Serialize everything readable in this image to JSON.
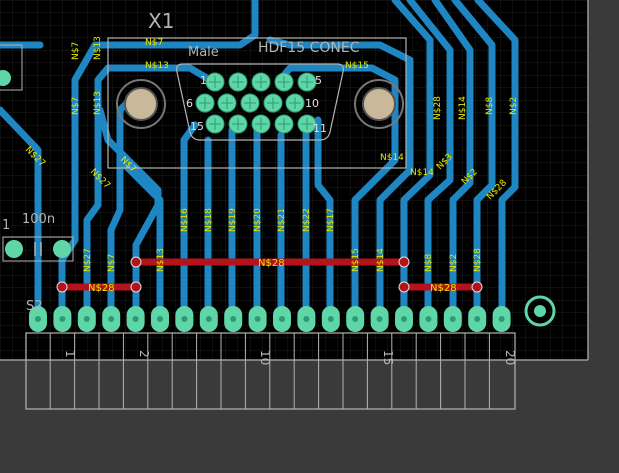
{
  "colors": {
    "canvas": "#3a3a3a",
    "board": "#000000",
    "grid": "#1c1c1c",
    "outline": "#b4b4b4",
    "trace_bottom": "#1e86c2",
    "trace_top": "#b3131a",
    "pad": "#5fd6a8",
    "text": "#e6e600",
    "silk": "#b0b0b0"
  },
  "component": {
    "name": "X1",
    "package": "HDF15 CONEC",
    "gender": "Male",
    "pin_labels": [
      "1",
      "5",
      "6",
      "10",
      "15",
      "11"
    ]
  },
  "capacitor": {
    "value": "100n",
    "index_label": "1"
  },
  "header": {
    "ref_fragment": "S2",
    "pin_numbers": [
      "1",
      "2",
      "10",
      "15",
      "20"
    ]
  },
  "nets": {
    "top_left": [
      "N$7",
      "N$13",
      "N$7",
      "N$13"
    ],
    "connector_top": [
      "N$7",
      "N$13",
      "N$15",
      "N$14",
      "N$14"
    ],
    "verticals_top": [
      "N$7",
      "N$13",
      "N$7",
      "N$13",
      "N$12",
      "N$3",
      "N$8",
      "N$2",
      "N$28",
      "N$14",
      "N$8",
      "N$2",
      "N$28"
    ],
    "verticals_mid": [
      "N$16",
      "N$18",
      "N$19",
      "N$20",
      "N$21",
      "N$22",
      "N$17"
    ],
    "verticals_low": [
      "N$27",
      "N$7",
      "N$13",
      "N$15",
      "N$14",
      "N$8",
      "N$2",
      "N$28"
    ],
    "bus_long": "N$28",
    "bus_left": "N$28",
    "bus_right": "N$28",
    "misc": [
      "N$27",
      "N$27",
      "N$7",
      "N$3",
      "N$2"
    ]
  }
}
